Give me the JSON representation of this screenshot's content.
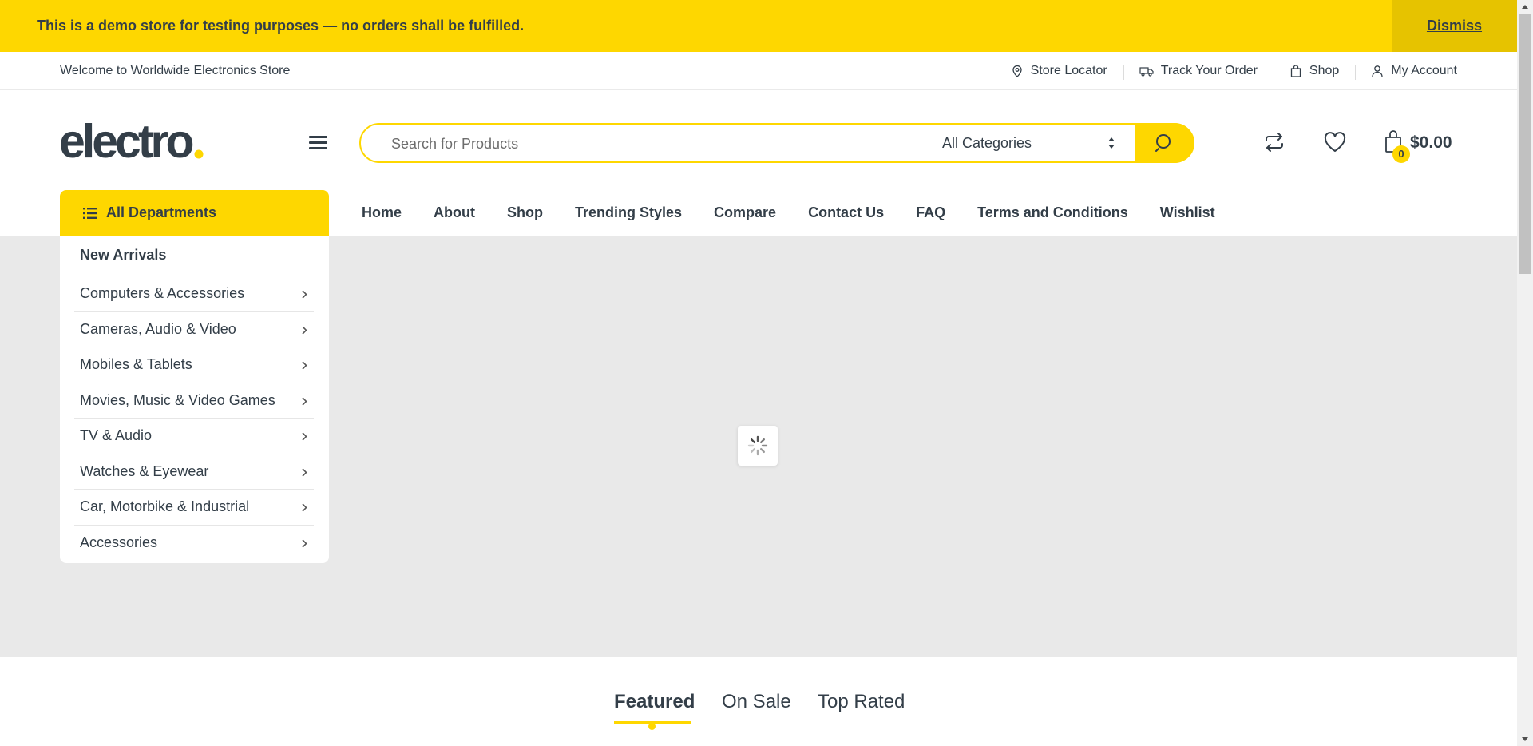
{
  "notice": {
    "text": "This is a demo store for testing purposes — no orders shall be fulfilled.",
    "dismiss": "Dismiss"
  },
  "topbar": {
    "welcome": "Welcome to Worldwide Electronics Store",
    "links": [
      {
        "icon": "map-pin-icon",
        "label": "Store Locator"
      },
      {
        "icon": "truck-icon",
        "label": "Track Your Order"
      },
      {
        "icon": "shopping-bag-icon",
        "label": "Shop"
      },
      {
        "icon": "user-icon",
        "label": "My Account"
      }
    ]
  },
  "header": {
    "logo_text": "electro",
    "search": {
      "placeholder": "Search for Products",
      "category_selected": "All Categories"
    },
    "cart": {
      "count": "0",
      "total": "$0.00"
    }
  },
  "nav": {
    "departments_label": "All Departments",
    "links": [
      "Home",
      "About",
      "Shop",
      "Trending Styles",
      "Compare",
      "Contact Us",
      "FAQ",
      "Terms and Conditions",
      "Wishlist"
    ]
  },
  "departments": {
    "first": "New Arrivals",
    "items": [
      "Computers & Accessories",
      "Cameras, Audio & Video",
      "Mobiles & Tablets",
      "Movies, Music & Video Games",
      "TV & Audio",
      "Watches & Eyewear",
      "Car, Motorbike & Industrial",
      "Accessories"
    ]
  },
  "tabs": {
    "items": [
      "Featured",
      "On Sale",
      "Top Rated"
    ],
    "active": "Featured"
  },
  "colors": {
    "accent": "#fed700",
    "dismiss_bg": "#e6c300",
    "text": "#333e48",
    "hero_bg": "#e9e9e9"
  }
}
